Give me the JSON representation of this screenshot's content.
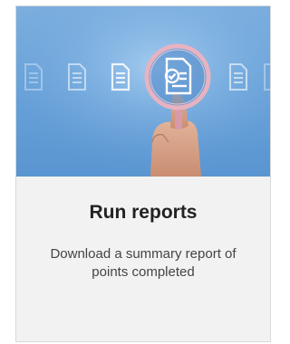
{
  "card": {
    "image_icon": "magnifier-document-icon",
    "title": "Run reports",
    "description": "Download a summary report of points completed"
  },
  "colors": {
    "hero_blue": "#6aa3da",
    "card_background": "#f2f2f2",
    "lens_rim": "#e7b3c1"
  }
}
